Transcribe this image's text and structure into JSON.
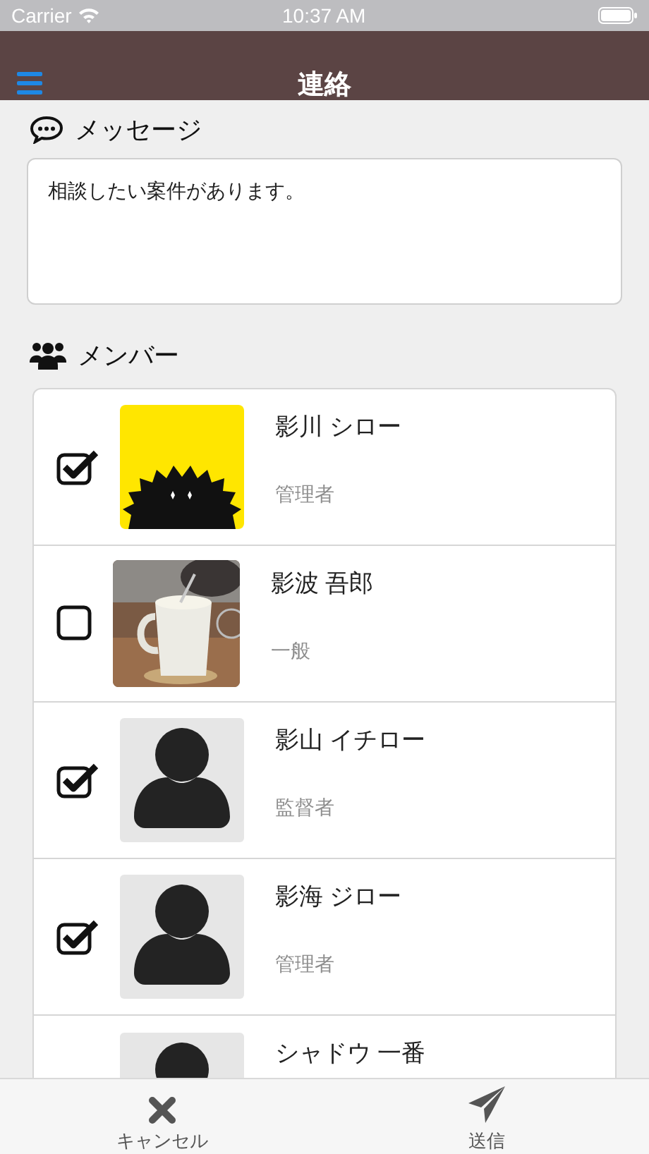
{
  "status_bar": {
    "carrier": "Carrier",
    "time": "10:37 AM"
  },
  "nav": {
    "title": "連絡"
  },
  "message": {
    "heading": "メッセージ",
    "value": "相談したい案件があります。"
  },
  "members": {
    "heading": "メンバー",
    "items": [
      {
        "name": "影川 シロー",
        "role": "管理者",
        "checked": true,
        "kind": "logo"
      },
      {
        "name": "影波 吾郎",
        "role": "一般",
        "checked": false
      },
      {
        "name": "影山 イチロー",
        "role": "監督者",
        "checked": true,
        "kind": "silhouette"
      },
      {
        "name": "影海 ジロー",
        "role": "管理者",
        "checked": true,
        "kind": "silhouette"
      },
      {
        "name": "シャドウ 一番",
        "kind": "silhouette"
      }
    ]
  },
  "toolbar": [
    {
      "label": "キャンセル",
      "kind": "cancel"
    },
    {
      "label": "送信",
      "kind": "send"
    }
  ]
}
